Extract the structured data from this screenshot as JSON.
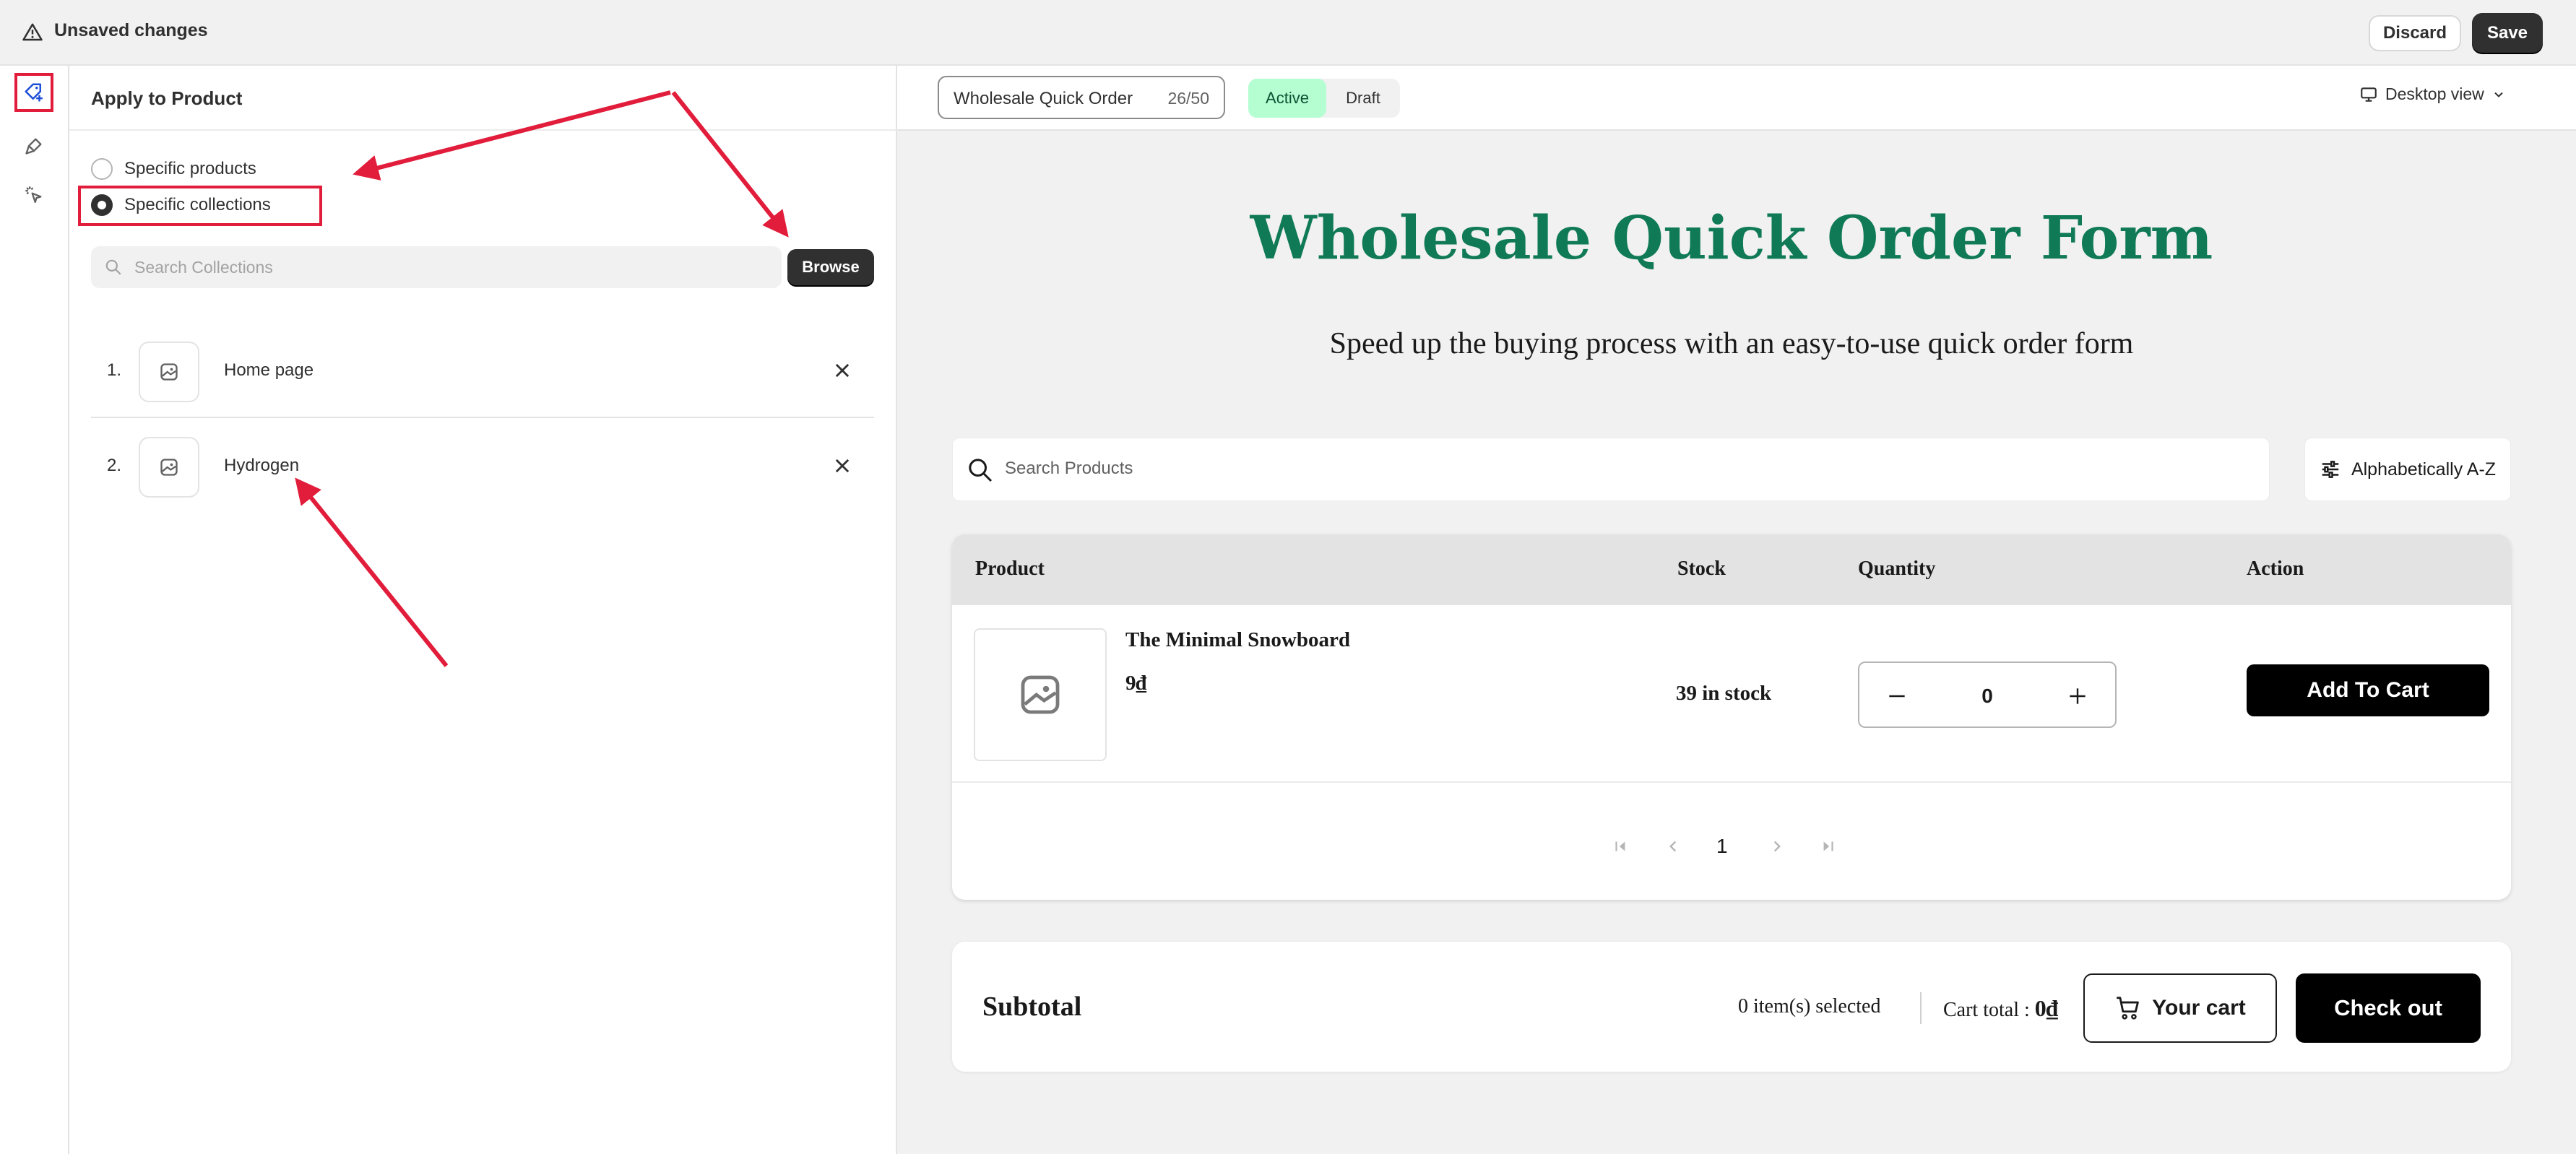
{
  "topbar": {
    "title": "Unsaved changes",
    "discard_label": "Discard",
    "save_label": "Save"
  },
  "panel": {
    "title": "Apply to Product",
    "options": [
      {
        "label": "Specific products",
        "selected": false
      },
      {
        "label": "Specific collections",
        "selected": true
      }
    ],
    "search_placeholder": "Search Collections",
    "browse_label": "Browse",
    "collections": [
      {
        "index": "1.",
        "name": "Home page"
      },
      {
        "index": "2.",
        "name": "Hydrogen"
      }
    ]
  },
  "preview_header": {
    "form_name": "Wholesale Quick Order",
    "char_count": "26/50",
    "status_active": "Active",
    "status_draft": "Draft",
    "device_label": "Desktop view"
  },
  "preview": {
    "title": "Wholesale Quick Order Form",
    "subtitle": "Speed up the buying process with an easy-to-use quick order form",
    "search_placeholder": "Search Products",
    "sort_label": "Alphabetically A-Z",
    "table": {
      "headers": [
        "Product",
        "Stock",
        "Quantity",
        "Action"
      ],
      "rows": [
        {
          "name": "The Minimal Snowboard",
          "price": "9₫",
          "stock": "39 in stock",
          "quantity": "0",
          "action_label": "Add To Cart"
        }
      ]
    },
    "pagination": {
      "current": "1"
    },
    "subtotal": {
      "label": "Subtotal",
      "selected_text": "0 item(s) selected",
      "cart_total_label": "Cart total : ",
      "cart_total_value": "0₫",
      "your_cart_label": "Your cart",
      "checkout_label": "Check out"
    },
    "title_color": "#0f7a55"
  },
  "annotation_color": "#e11d3b"
}
